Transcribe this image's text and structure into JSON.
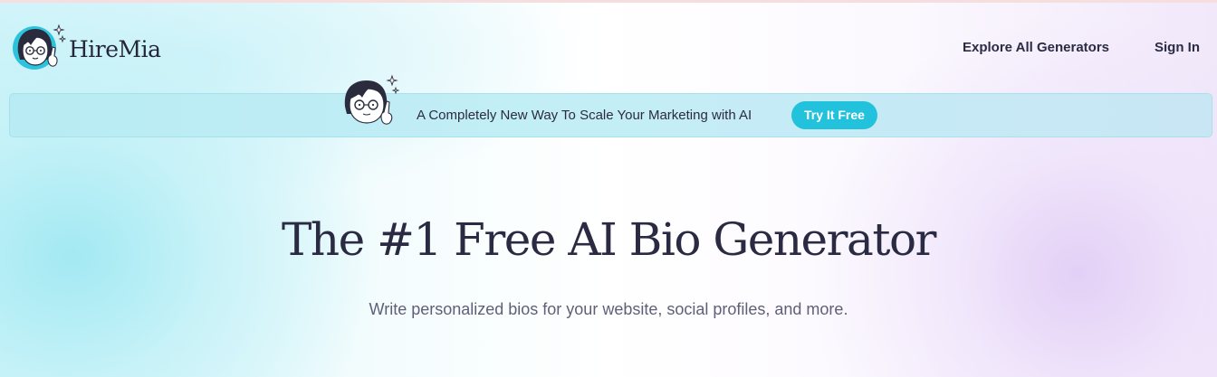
{
  "header": {
    "brand": "HireMia",
    "nav": {
      "explore": "Explore All Generators",
      "signin": "Sign In"
    }
  },
  "banner": {
    "text": "A Completely New Way To Scale Your Marketing with AI",
    "cta": "Try It Free"
  },
  "hero": {
    "title": "The #1 Free AI Bio Generator",
    "subtitle": "Write personalized bios for your website, social profiles, and more."
  },
  "colors": {
    "accent": "#23c2dc",
    "banner_bg": "#c4eef6",
    "text_dark": "#2a2a42",
    "text_muted": "#5f5f78"
  },
  "icons": [
    "mascot-logo-icon",
    "mascot-banner-icon",
    "sparkle-icon"
  ]
}
